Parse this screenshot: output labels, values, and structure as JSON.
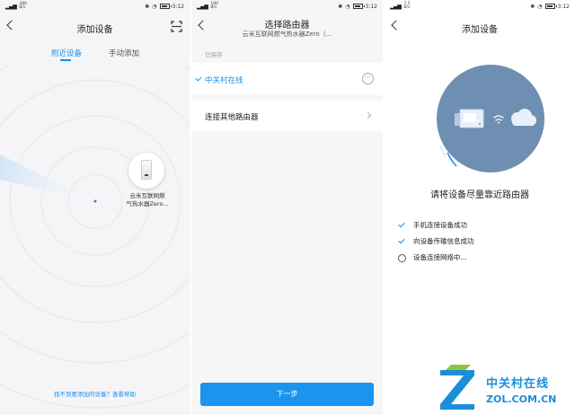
{
  "status": {
    "time": "3:12",
    "net_speed_1": "380",
    "net_speed_2": "180",
    "net_speed_3": "7.5",
    "net_unit": "B/s"
  },
  "screen1": {
    "title": "添加设备",
    "tabs": [
      {
        "label": "附近设备",
        "active": true
      },
      {
        "label": "手动添加",
        "active": false
      }
    ],
    "device_name_line1": "云米互联网燃",
    "device_name_line2": "气热水器Zero...",
    "help_link": "找不到要添加的设备？查看帮助"
  },
  "screen2": {
    "title": "选择路由器",
    "subtitle": "云米互联网燃气热水器Zero（...",
    "saved_label": "已保存",
    "saved_network": "中关村在线",
    "more_glyph": "···",
    "other_router": "连接其他路由器",
    "next_button": "下一步"
  },
  "screen3": {
    "title": "添加设备",
    "hint": "请将设备尽量靠近路由器",
    "steps": [
      {
        "label": "手机连接设备成功",
        "done": true
      },
      {
        "label": "向设备传输信息成功",
        "done": true
      },
      {
        "label": "设备连接网络中...",
        "done": false
      }
    ]
  },
  "watermark": {
    "name": "中关村在线",
    "url": "ZOL.COM.CN"
  },
  "colors": {
    "accent": "#1a8fe6",
    "circle": "#6f8fb2"
  }
}
